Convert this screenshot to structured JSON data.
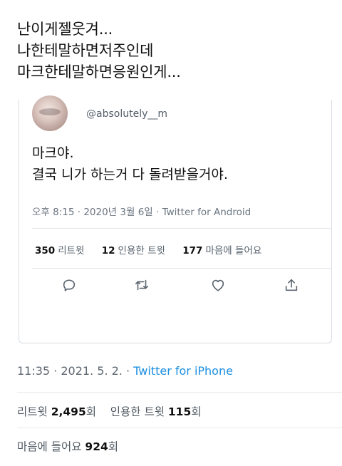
{
  "tweet": {
    "lines": [
      "난이게젤웃겨...",
      "나한테말하면저주인데",
      "마크한테말하면응원인게..."
    ]
  },
  "quote": {
    "handle": "@absolutely__m",
    "lines": [
      "마크야.",
      "결국 니가 하는거 다 돌려받을거야."
    ],
    "meta": "오후 8:15 · 2020년 3월 6일 · Twitter for Android",
    "stats": {
      "retweets_num": "350",
      "retweets_label": "리트윗",
      "quotes_num": "12",
      "quotes_label": "인용한 트윗",
      "likes_num": "177",
      "likes_label": "마음에 들어요"
    },
    "actions": [
      "reply-icon",
      "retweet-icon",
      "like-icon",
      "share-icon"
    ]
  },
  "meta": {
    "time_date": "11:35 · 2021. 5. 2. · ",
    "source": "Twitter for iPhone"
  },
  "stats": {
    "retweets_label": "리트윗 ",
    "retweets_num": "2,495",
    "retweets_unit": "회",
    "quotes_label": "인용한 트윗 ",
    "quotes_num": "115",
    "quotes_unit": "회",
    "likes_label": "마음에 들어요 ",
    "likes_num": "924",
    "likes_unit": "회"
  },
  "colors": {
    "link": "#1d8fe0",
    "muted": "#6b7580",
    "border": "#d8dde2"
  }
}
